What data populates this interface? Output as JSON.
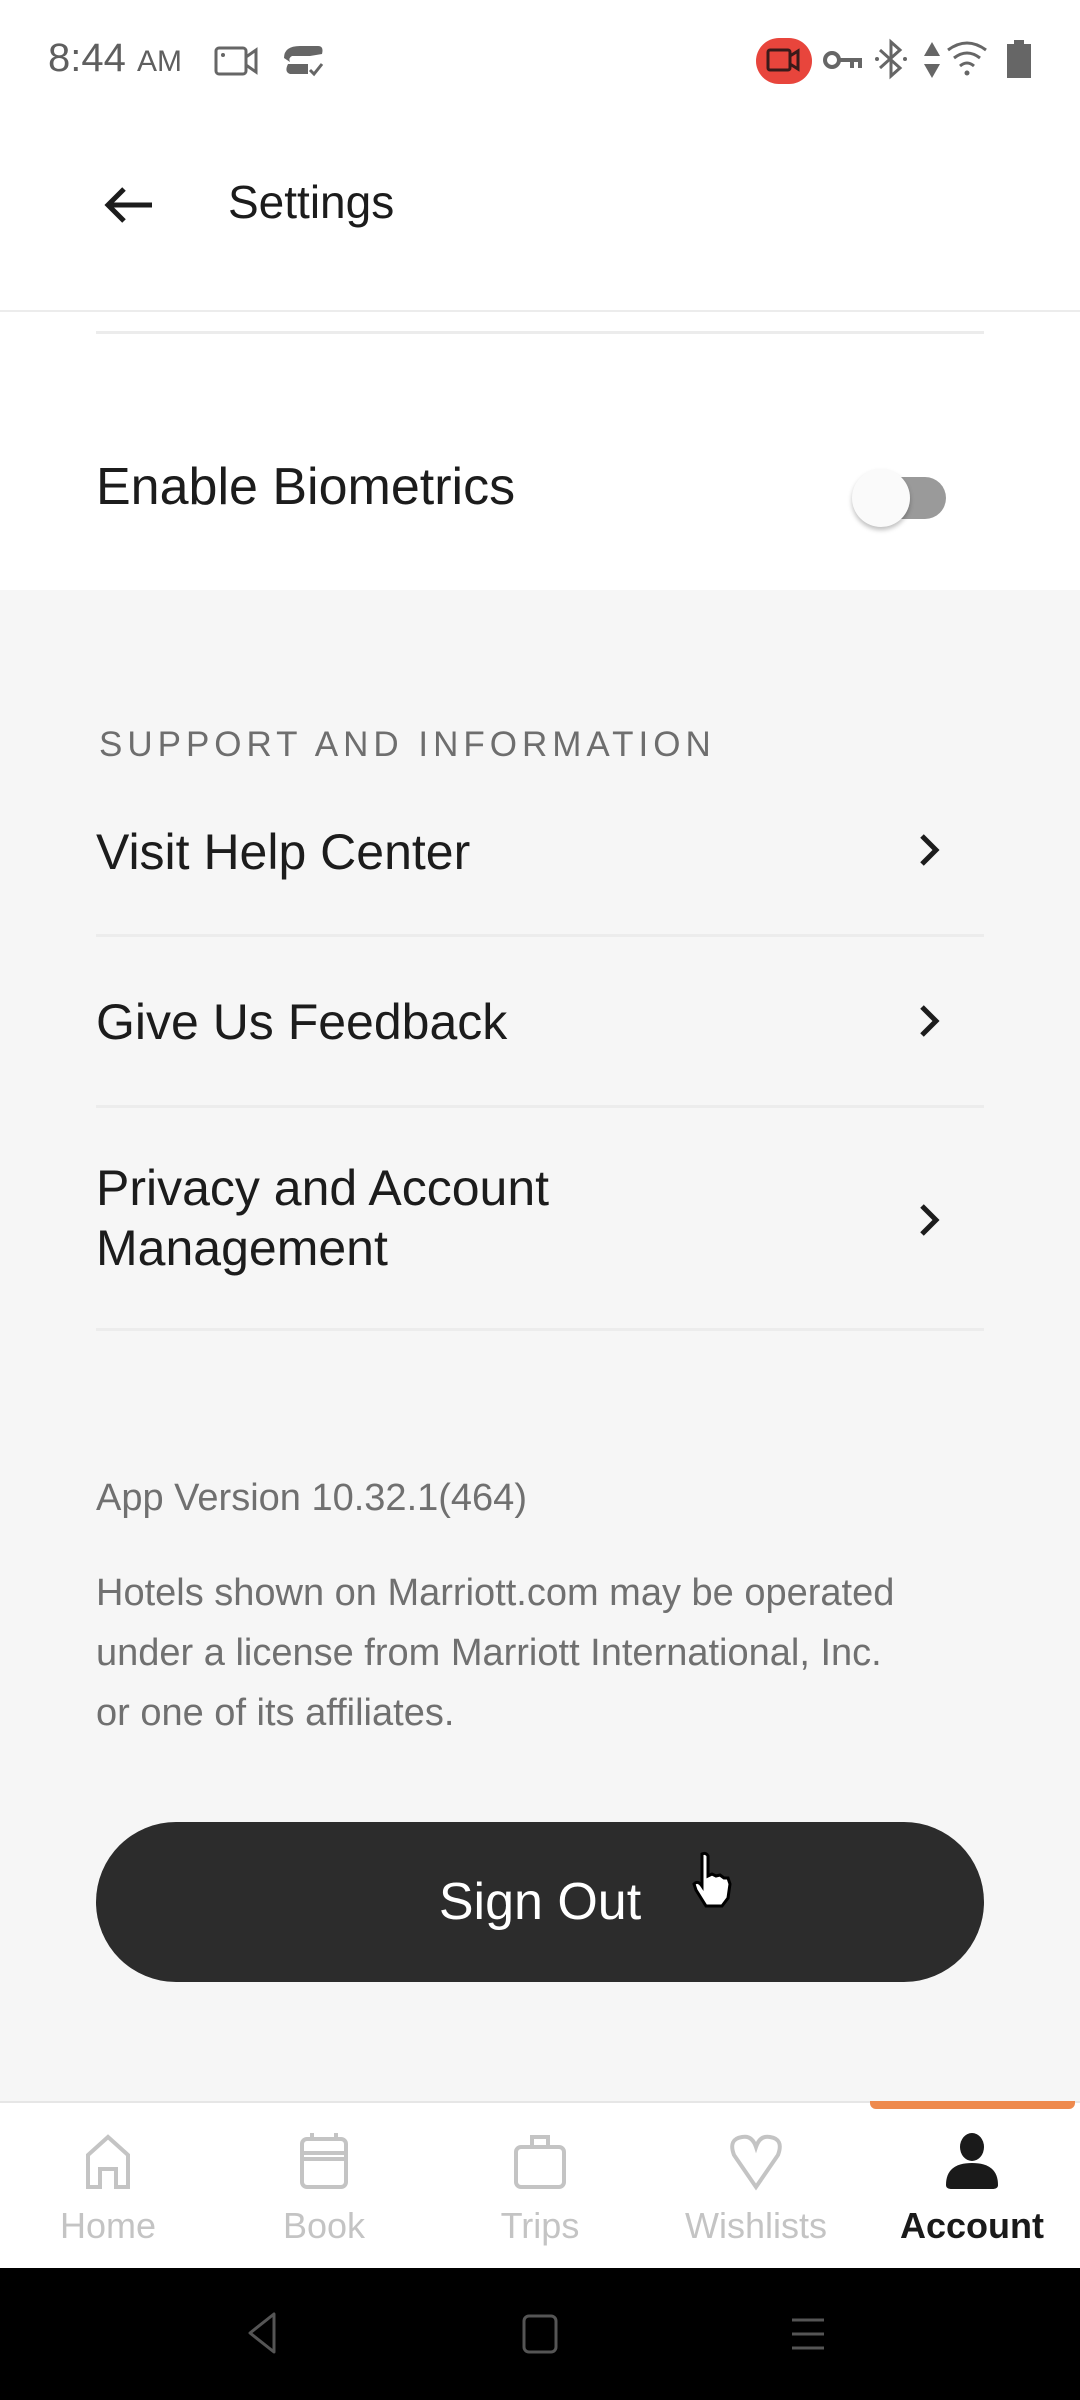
{
  "status_bar": {
    "time": "8:44",
    "ampm": "AM",
    "left_icons": [
      "screen-record-icon",
      "sync-icon"
    ],
    "right_icons": [
      "recording-active-icon",
      "vpn-key-icon",
      "bluetooth-icon",
      "data-arrows-icon",
      "wifi-icon",
      "battery-icon"
    ],
    "recording_color": "#e8453c"
  },
  "header": {
    "back_icon": "arrow-left-icon",
    "title": "Settings"
  },
  "security": {
    "biometrics_label": "Enable Biometrics",
    "biometrics_enabled": false
  },
  "support": {
    "section_title": "SUPPORT AND INFORMATION",
    "items": [
      {
        "label": "Visit Help Center",
        "icon": "chevron-right-icon"
      },
      {
        "label": "Give Us Feedback",
        "icon": "chevron-right-icon"
      },
      {
        "label": "Privacy and Account Management",
        "icon": "chevron-right-icon"
      }
    ]
  },
  "footer": {
    "app_version": "App Version 10.32.1(464)",
    "disclaimer": "Hotels shown on Marriott.com may be operated under a license from Marriott International, Inc. or one of its affiliates."
  },
  "sign_out_label": "Sign Out",
  "bottom_nav": {
    "active": "Account",
    "accent_color": "#ee8a4e",
    "tabs": [
      {
        "label": "Home",
        "icon": "home-icon"
      },
      {
        "label": "Book",
        "icon": "calendar-icon"
      },
      {
        "label": "Trips",
        "icon": "suitcase-icon"
      },
      {
        "label": "Wishlists",
        "icon": "heart-icon"
      },
      {
        "label": "Account",
        "icon": "person-icon"
      }
    ]
  },
  "system_nav": [
    "back-nav-icon",
    "home-nav-icon",
    "recents-nav-icon"
  ]
}
